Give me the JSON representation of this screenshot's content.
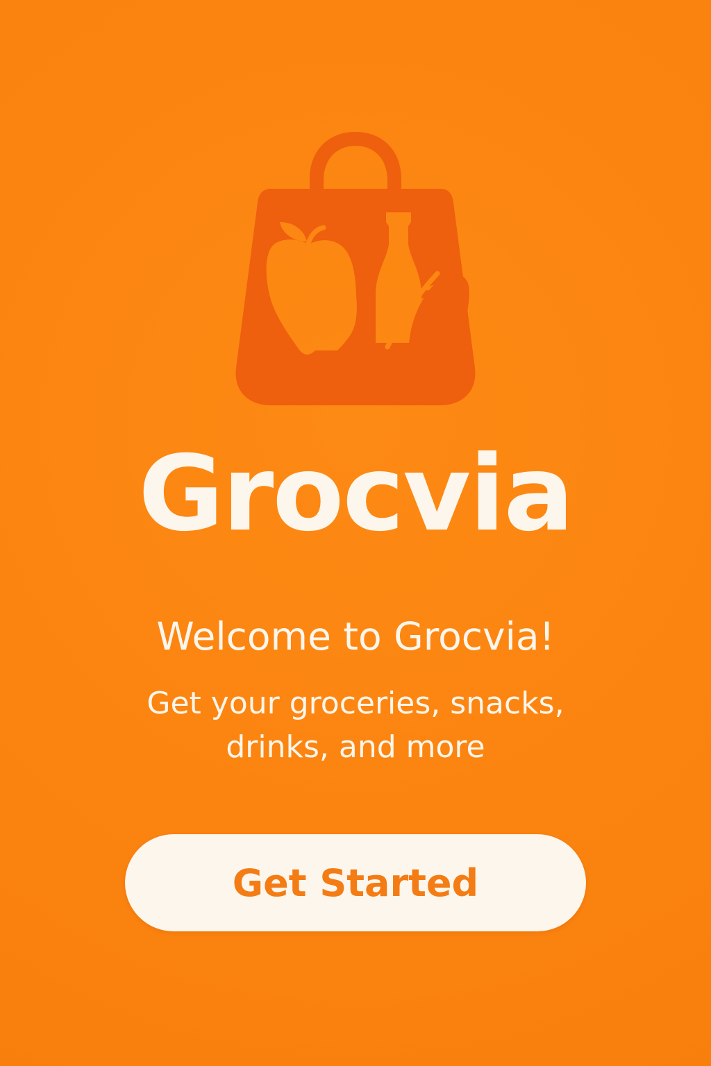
{
  "app": {
    "name": "Grocvia"
  },
  "welcome": {
    "title": "Welcome to Grocvia!",
    "subtitle": "Get your groceries, snacks, drinks, and more"
  },
  "actions": {
    "get_started_label": "Get Started"
  },
  "icons": {
    "logo": "shopping-bag-with-groceries-icon"
  },
  "colors": {
    "background": "#FB8410",
    "logo": "#EE5F0E",
    "text": "#FCF6EC",
    "button_background": "#FDF6EC",
    "button_text": "#F47C14"
  }
}
